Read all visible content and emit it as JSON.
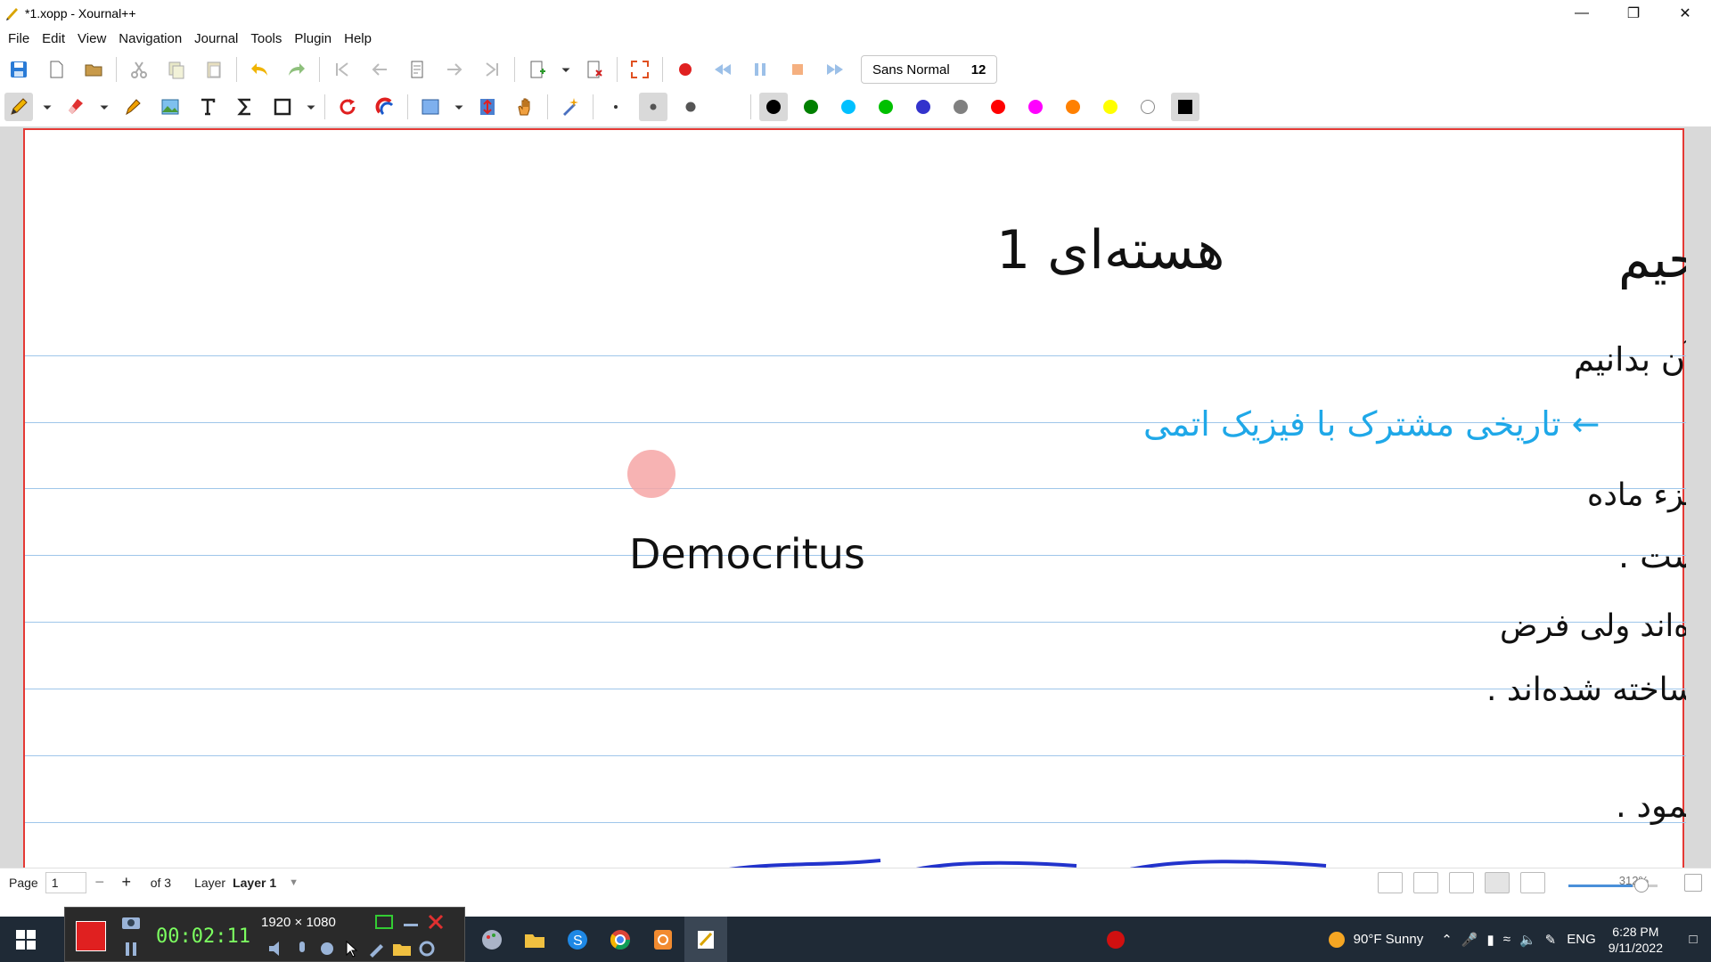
{
  "window": {
    "title": "*1.xopp - Xournal++",
    "controls": [
      "minimize-icon",
      "restore-icon",
      "close-icon"
    ]
  },
  "menu": [
    "File",
    "Edit",
    "View",
    "Navigation",
    "Journal",
    "Tools",
    "Plugin",
    "Help"
  ],
  "toolbar": {
    "font_name": "Sans Normal",
    "font_size": "12",
    "pen_colors": [
      "#000000",
      "#008000",
      "#00c0ff",
      "#00c000",
      "#3333cc",
      "#808080",
      "#ff0000",
      "#ff00ff",
      "#ff8000",
      "#ffff00",
      "#ffffff"
    ],
    "selected_color": "#000000"
  },
  "page_content": {
    "heading_bismillah": "بسم الله الرحمن الرحیم",
    "heading_session": "هسته‌ای 1",
    "line1": "* برای فهم بهتر فیزیک هسته‌ای لازم است که در ابتدا کمی در مورد تاریخچهٔ آن بدانیم",
    "line2": "← تاریخی مشترک با فیزیک اتمی",
    "line3": "* تئوری اتم در یونان باستان برای اولین بار توسط دموکریتوس مطرح شد که در آن اتم ریزترین جزء ماده",
    "line4_latin": "Democritus",
    "line4": "است و تقسیم ناشدنی است .",
    "line5": "← علم جدید موید این موضوع هست که مواد از واحدهای ریزی به نام اتم تشکیل شده‌اند ولی فرض",
    "line6": "تقسیم ناپذیر بودن آن زیر سوال رفت و ثابت شد اتم‌ها از اجزاء ریزی ساخته شده‌اند .",
    "line7": "* مهمترین قدم‌ها در مسیر تکوین و تکامل فیزیک هسته‌ای را می توان به صورت زیر خلاصه نمود ."
  },
  "status": {
    "page_label": "Page",
    "page_value": "1",
    "page_total": "of 3",
    "layer_label": "Layer",
    "layer_value": "Layer 1",
    "zoom": "312%",
    "zoom_level": 0.72
  },
  "recorder": {
    "timer": "00:02:11",
    "resolution": "1920 × 1080"
  },
  "taskbar": {
    "weather": "90°F  Sunny",
    "language": "ENG",
    "time": "6:28 PM",
    "date": "9/11/2022"
  },
  "colors": {
    "page_border": "#e53935",
    "ruled_line": "#9fc6ea",
    "ink_black": "#111111",
    "ink_cyan": "#1fa8e8",
    "ink_blue": "#2233cc",
    "laser_dot": "#f6a6a6"
  }
}
